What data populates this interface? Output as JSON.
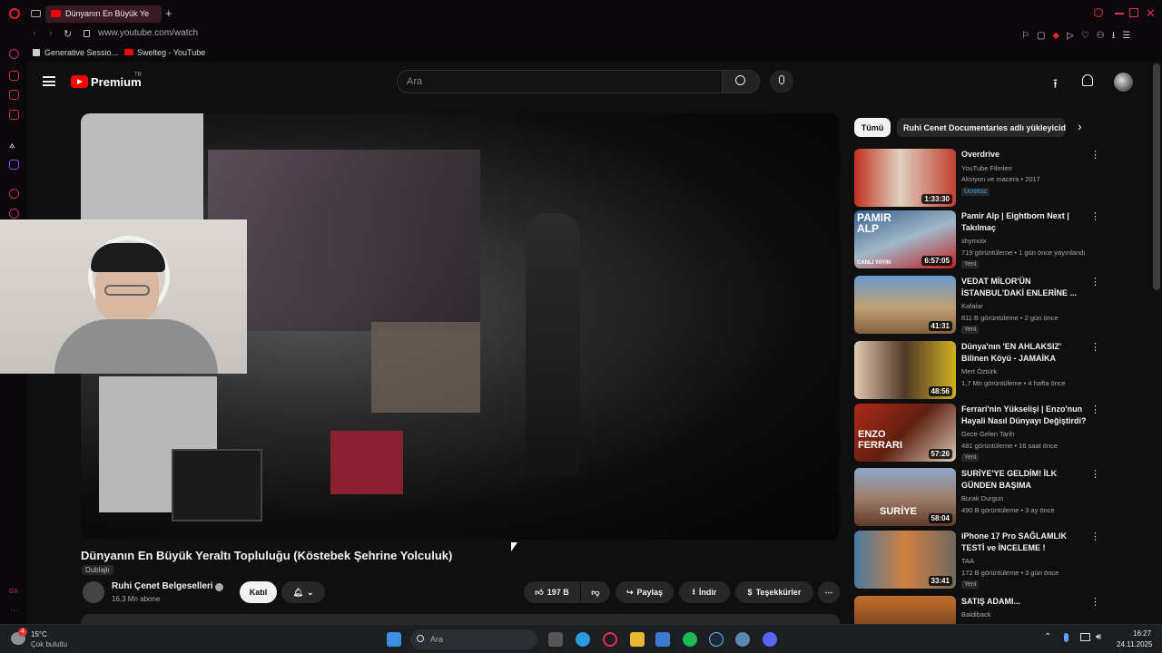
{
  "browser": {
    "tab_title": "Dünyanın En Büyük Ye",
    "url": "www.youtube.com/watch",
    "bookmarks": [
      "Generative Sessio...",
      "Swelteg - YouTube"
    ]
  },
  "yt": {
    "logo": "Premium",
    "logo_region": "TR",
    "search_placeholder": "Ara"
  },
  "video": {
    "title": "Dünyanın En Büyük Yeraltı Topluluğu (Köstebek Şehrine Yolculuk)",
    "dub_label": "Dublajlı",
    "channel": "Ruhi Çenet Belgeselleri",
    "subs": "16,3 Mn abone",
    "join": "Katıl",
    "likes": "197 B",
    "share": "Paylaş",
    "download": "İndir",
    "thanks": "Teşekkürler"
  },
  "chips": [
    "Tümü",
    "Ruhi Cenet Documentaries adlı yükleyiciden"
  ],
  "recs": [
    {
      "title": "Overdrive",
      "channel": "YouTube Filmleri",
      "meta": "Aksiyon ve macera • 2017",
      "badge": "Ücretsiz",
      "dur": "1:33:30"
    },
    {
      "title": "Pamir Alp | Eightborn Next | Takılmaç",
      "channel": "shymoix",
      "meta": "719 görüntüleme • 1 gün önce yayınlandı",
      "badge": "Yeni",
      "dur": "6:57:05"
    },
    {
      "title": "VEDAT MİLOR'ÜN İSTANBUL'DAKİ ENLERİNE ...",
      "channel": "Kafalar",
      "meta": "811 B görüntüleme • 2 gün önce",
      "badge": "Yeni",
      "dur": "41:31"
    },
    {
      "title": "Dünya'nın 'EN AHLAKSIZ' Bilinen Köyü - JAMAİKA",
      "channel": "Mert Öztürk",
      "meta": "1,7 Mn görüntüleme • 4 hafta önce",
      "badge": "",
      "dur": "48:56"
    },
    {
      "title": "Ferrari'nin Yükselişi | Enzo'nun Hayali Nasıl Dünyayı Değiştirdi?",
      "channel": "Gece Gelen Tarih",
      "meta": "481 görüntüleme • 16 saat önce",
      "badge": "Yeni",
      "dur": "57:26"
    },
    {
      "title": "SURİYE'YE GELDİM! İLK GÜNDEN BAŞIMA GELENLERE...",
      "channel": "Burak Durgun",
      "meta": "490 B görüntüleme • 3 ay önce",
      "badge": "",
      "dur": "58:04"
    },
    {
      "title": "iPhone 17 Pro SAĞLAMLIK TESTİ ve İNCELEME !",
      "channel": "TAA",
      "meta": "172 B görüntüleme • 3 gün önce",
      "badge": "Yeni",
      "dur": "33:41"
    },
    {
      "title": "SATIŞ ADAMI...",
      "channel": "Baldiback",
      "meta": "",
      "badge": "",
      "dur": ""
    }
  ],
  "thumbtext": {
    "pamir": "PAMIR ALP",
    "canli": "CANLI YAYIN",
    "enzo": "ENZO FERRARI",
    "suriye": "SURİYE"
  },
  "taskbar": {
    "weather_temp": "15°C",
    "weather_desc": "Çok bulutlu",
    "weather_badge": "4",
    "search": "Ara",
    "time": "16:27",
    "date": "24.11.2025"
  }
}
